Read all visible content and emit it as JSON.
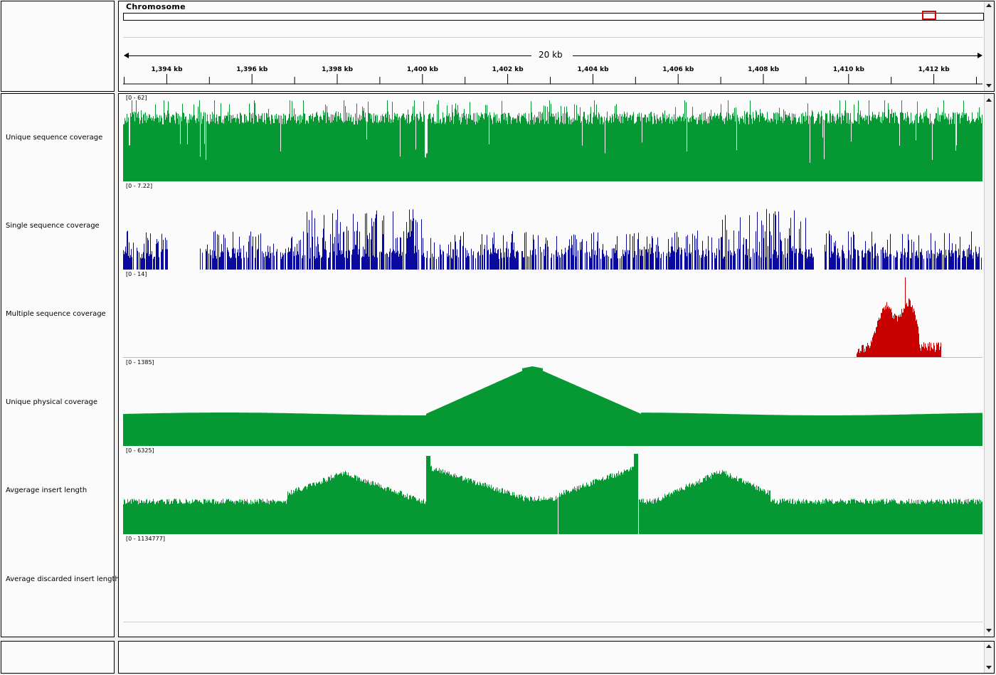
{
  "header": {
    "chromosome_label": "Chromosome",
    "span_label": "20 kb",
    "ticks": [
      "1,394 kb",
      "1,396 kb",
      "1,398 kb",
      "1,400 kb",
      "1,402 kb",
      "1,404 kb",
      "1,406 kb",
      "1,408 kb",
      "1,410 kb",
      "1,412 kb"
    ]
  },
  "tracks": [
    {
      "name": "Unique sequence coverage",
      "range": "[0 - 62]",
      "color": "#069933"
    },
    {
      "name": "Single sequence coverage",
      "range": "[0 - 7.22]",
      "color": "#0a0a9e"
    },
    {
      "name": "Multiple sequence coverage",
      "range": "[0 - 14]",
      "color": "#c80000"
    },
    {
      "name": "Unique physical coverage",
      "range": "[0 - 1385]",
      "color": "#069933"
    },
    {
      "name": "Avgerage insert length",
      "range": "[0 - 6325]",
      "color": "#069933"
    },
    {
      "name": "Average discarded insert length",
      "range": "[0 - 1134777]",
      "color": "#069933"
    }
  ],
  "colors": {
    "region_box": "#e00000",
    "background": "#fbfbfb"
  }
}
